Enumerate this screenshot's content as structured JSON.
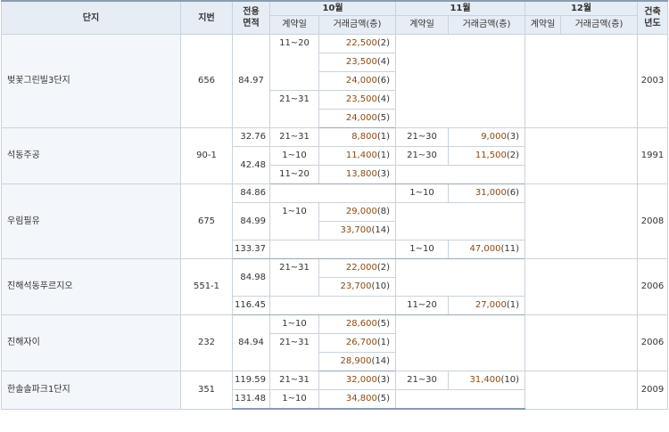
{
  "header": {
    "complex": "단지",
    "lot": "지번",
    "area": "전용\n면적",
    "months": [
      "10월",
      "11월",
      "12월"
    ],
    "contract_day": "계약일",
    "amount": "거래금액(층)",
    "built_year": "건축\n년도"
  },
  "complexes": [
    {
      "name": "벚꽃그린빌3단지",
      "lot": "656",
      "year": "2003",
      "areas": [
        "84.97"
      ],
      "deals": [
        {
          "day": "11~20",
          "price": "22,500",
          "floor": "(2)"
        },
        {
          "price": "23,500",
          "floor": "(4)"
        },
        {
          "price": "24,000",
          "floor": "(6)"
        },
        {
          "day": "21~31",
          "price": "23,500",
          "floor": "(4)"
        },
        {
          "price": "24,000",
          "floor": "(5)"
        }
      ]
    },
    {
      "name": "석동주공",
      "lot": "90-1",
      "year": "1991",
      "areas": [
        "32.76",
        "42.48"
      ],
      "deals": [
        {
          "day": "21~31",
          "price": "8,800",
          "floor": "(1)",
          "nov_day": "21~30",
          "nov_price": "9,000",
          "nov_floor": "(3)"
        },
        {
          "day": "1~10",
          "price": "11,400",
          "floor": "(1)",
          "nov_day": "21~30",
          "nov_price": "11,500",
          "nov_floor": "(2)"
        },
        {
          "day": "11~20",
          "price": "13,800",
          "floor": "(3)"
        }
      ]
    },
    {
      "name": "우림필유",
      "lot": "675",
      "year": "2008",
      "areas": [
        "84.86",
        "84.99",
        "133.37"
      ],
      "deals": [
        {
          "nov_day": "1~10",
          "nov_price": "31,000",
          "nov_floor": "(6)"
        },
        {
          "day": "1~10",
          "price": "29,000",
          "floor": "(8)"
        },
        {
          "price": "33,700",
          "floor": "(14)"
        },
        {
          "nov_day": "1~10",
          "nov_price": "47,000",
          "nov_floor": "(11)"
        }
      ]
    },
    {
      "name": "진해석동푸르지오",
      "lot": "551-1",
      "year": "2006",
      "areas": [
        "84.98",
        "116.45"
      ],
      "deals": [
        {
          "day": "21~31",
          "price": "22,000",
          "floor": "(2)"
        },
        {
          "price": "23,700",
          "floor": "(10)"
        },
        {
          "nov_day": "11~20",
          "nov_price": "27,000",
          "nov_floor": "(1)"
        }
      ]
    },
    {
      "name": "진해자이",
      "lot": "232",
      "year": "2006",
      "areas": [
        "84.94"
      ],
      "deals": [
        {
          "day": "1~10",
          "price": "28,600",
          "floor": "(5)"
        },
        {
          "day": "21~31",
          "price": "26,700",
          "floor": "(1)"
        },
        {
          "price": "28,900",
          "floor": "(14)"
        }
      ]
    },
    {
      "name": "한솔솔파크1단지",
      "lot": "351",
      "year": "2009",
      "areas": [
        "119.59",
        "131.48"
      ],
      "deals": [
        {
          "day": "21~31",
          "price": "32,000",
          "floor": "(3)",
          "nov_day": "21~30",
          "nov_price": "31,400",
          "nov_floor": "(10)"
        },
        {
          "day": "1~10",
          "price": "34,800",
          "floor": "(5)"
        }
      ]
    }
  ]
}
